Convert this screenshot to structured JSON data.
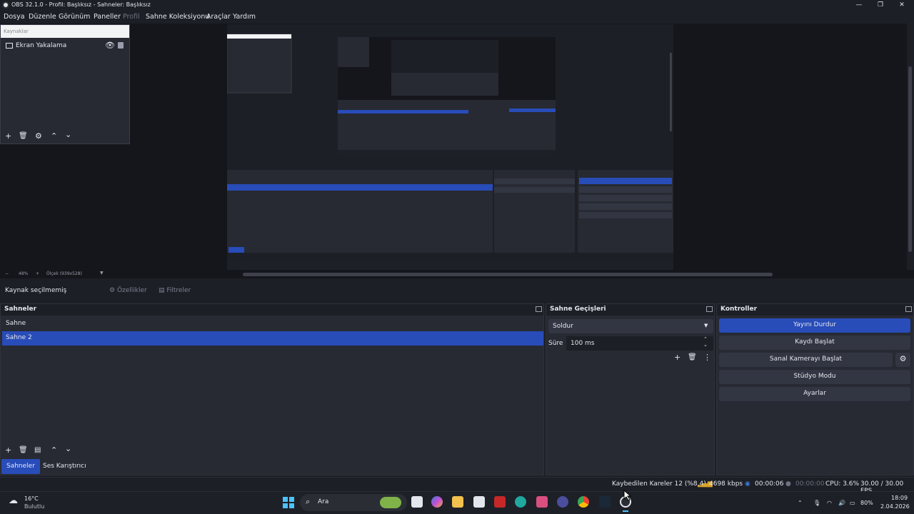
{
  "window": {
    "title": "OBS 32.1.0 - Profil: Başlıksız - Sahneler: Başlıksız"
  },
  "menu": [
    "Dosya",
    "Düzenle",
    "Görünüm",
    "Paneller",
    "Profil",
    "Sahne Koleksiyonu",
    "Araçlar",
    "Yardım"
  ],
  "sources": {
    "header": "Kaynaklar",
    "items": [
      {
        "label": "Ekran Yakalama"
      }
    ]
  },
  "preview": {
    "zoom": "48%",
    "canvas_info": "Ölçek (939x528)"
  },
  "context": {
    "no_source": "Kaynak seçilmemiş",
    "properties": "Özellikler",
    "filters": "Filtreler"
  },
  "scenes": {
    "title": "Sahneler",
    "items": [
      {
        "label": "Sahne",
        "selected": false
      },
      {
        "label": "Sahne 2",
        "selected": true
      }
    ]
  },
  "transitions": {
    "title": "Sahne Geçişleri",
    "selected": "Soldur",
    "duration_label": "Süre",
    "duration_value": "100 ms"
  },
  "controls": {
    "title": "Kontroller",
    "buttons": [
      "Yayını Durdur",
      "Kaydı Başlat",
      "Sanal Kamerayı Başlat",
      "Stüdyo Modu",
      "Ayarlar"
    ]
  },
  "bottom_tabs": [
    "Sahneler",
    "Ses Karıştırıcı"
  ],
  "status": {
    "dropped": "Kaybedilen Kareler 12 (%8.4)",
    "bitrate": "4698 kbps",
    "stream_time": "00:00:06",
    "rec_time": "00:00:00",
    "cpu": "CPU: 3.6%",
    "fps": "30.00 / 30.00 FPS"
  },
  "taskbar": {
    "weather_temp": "16°C",
    "weather_desc": "Bulutlu",
    "search": "Ara",
    "battery": "80%",
    "time": "18:09",
    "date": "2.04.2026"
  },
  "colors": {
    "accent": "#284cb8",
    "panel": "#272a33",
    "background": "#1d1f26"
  }
}
